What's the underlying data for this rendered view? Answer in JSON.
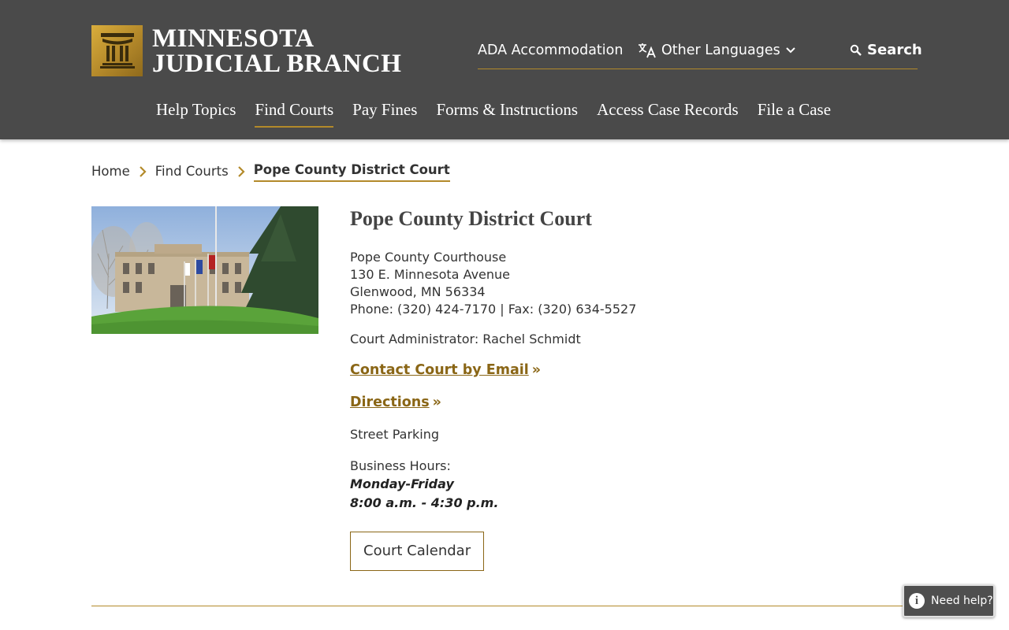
{
  "header": {
    "logo_line1": "MINNESOTA",
    "logo_line2": "JUDICIAL BRANCH",
    "utility": {
      "ada": "ADA Accommodation",
      "languages": "Other Languages",
      "search": "Search"
    },
    "nav": [
      {
        "label": "Help Topics",
        "active": false
      },
      {
        "label": "Find Courts",
        "active": true
      },
      {
        "label": "Pay Fines",
        "active": false
      },
      {
        "label": "Forms & Instructions",
        "active": false
      },
      {
        "label": "Access Case Records",
        "active": false
      },
      {
        "label": "File a Case",
        "active": false
      }
    ]
  },
  "breadcrumb": {
    "items": [
      "Home",
      "Find Courts"
    ],
    "current": "Pope County District Court"
  },
  "court": {
    "title": "Pope County District Court",
    "address_lines": [
      "Pope County Courthouse",
      "130 E. Minnesota Avenue",
      "Glenwood, MN 56334",
      "Phone: (320) 424-7170 | Fax: (320) 634-5527"
    ],
    "administrator": "Court Administrator: Rachel Schmidt",
    "contact_link": "Contact Court by Email",
    "contact_arrow": "»",
    "directions_link": "Directions",
    "directions_arrow": "»",
    "parking": "Street Parking",
    "hours_label": "Business Hours:",
    "hours_days": "Monday-Friday",
    "hours_times": "8:00 a.m. - 4:30 p.m.",
    "calendar_button": "Court Calendar"
  },
  "help_widget": {
    "label": "Need help?",
    "icon_glyph": "i"
  },
  "colors": {
    "header_bg": "#4a4a4a",
    "accent_gold": "#b38a2a",
    "link_gold": "#8a6616"
  }
}
